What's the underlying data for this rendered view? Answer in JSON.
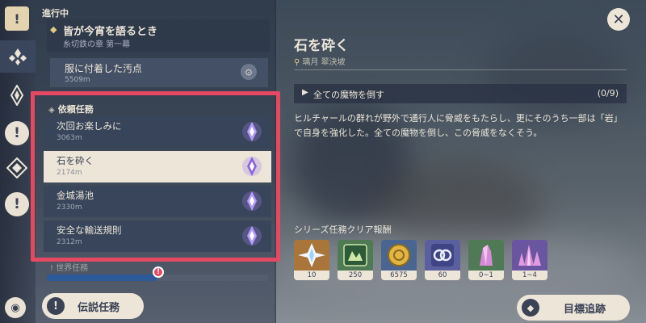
{
  "sidebar": {
    "status_label": "進行中",
    "archon": {
      "title": "皆が今宵を語るとき",
      "subtitle": "糸切鉄の章 第一幕"
    },
    "quest_above": {
      "name": "服に付着した汚点",
      "distance": "5509m"
    },
    "commissions_header": "依頼任務",
    "commissions": [
      {
        "name": "次回お楽しみに",
        "distance": "3063m",
        "selected": false
      },
      {
        "name": "石を砕く",
        "distance": "2174m",
        "selected": true
      },
      {
        "name": "金城湯池",
        "distance": "2330m",
        "selected": false
      },
      {
        "name": "安全な輸送規則",
        "distance": "2312m",
        "selected": false
      }
    ],
    "world_quests_label": "世界任務",
    "world_progress": 0.5,
    "legend_button": "伝説任務"
  },
  "detail": {
    "title": "石を砕く",
    "location": "璃月 翠決坡",
    "objective": {
      "text": "全ての魔物を倒す",
      "count": "(0/9)"
    },
    "description": "ヒルチャールの群れが野外で通行人に脅威をもたらし、更にそのうち一部は「岩」で自身を強化した。全ての魔物を倒し、この脅威をなくそう。",
    "reward_label": "シリーズ任務クリア報酬",
    "rewards": [
      {
        "icon": "primogem-icon",
        "count": "10",
        "bg": "#a9753a"
      },
      {
        "icon": "adventure-exp-icon",
        "count": "250",
        "bg": "#4f7a55"
      },
      {
        "icon": "mora-icon",
        "count": "6575",
        "bg": "#4a6690"
      },
      {
        "icon": "companionship-exp-icon",
        "count": "60",
        "bg": "#5a5fa0"
      },
      {
        "icon": "crystal-ore-icon",
        "count": "0~1",
        "bg": "#4f7a55"
      },
      {
        "icon": "crystal-cluster-icon",
        "count": "1~4",
        "bg": "#6a55a0"
      }
    ],
    "track_button": "目標追跡"
  },
  "colors": {
    "highlight": "#e64862",
    "cream": "#ece5d8",
    "dark": "#3b4255"
  }
}
